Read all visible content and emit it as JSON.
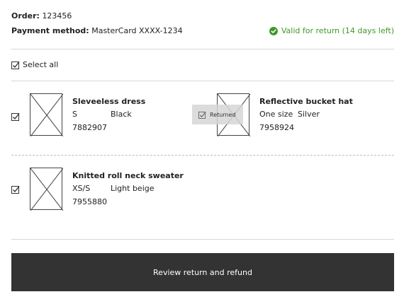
{
  "order": {
    "label": "Order:",
    "number": "123456"
  },
  "payment": {
    "label": "Payment method:",
    "value": "MasterCard XXXX-1234"
  },
  "return_status": {
    "text": "Valid for return (14 days left)",
    "color": "#3d9a28",
    "icon": "check-circle-icon"
  },
  "select_all": {
    "label": "Select all",
    "checked": true
  },
  "items": [
    {
      "title": "Sleveeless dress",
      "size": "S",
      "color": "Black",
      "sku": "7882907",
      "checked": true,
      "returned": false
    },
    {
      "title": "Reflective bucket hat",
      "size": "One size",
      "color": "Silver",
      "sku": "7958924",
      "checked": false,
      "returned": true,
      "returned_label": "Returned"
    },
    {
      "title": "Knitted roll neck sweater",
      "size": "XS/S",
      "color": "Light beige",
      "sku": "7955880",
      "checked": true,
      "returned": false
    }
  ],
  "actions": {
    "review_label": "Review return and refund",
    "button_color": "#333333"
  }
}
